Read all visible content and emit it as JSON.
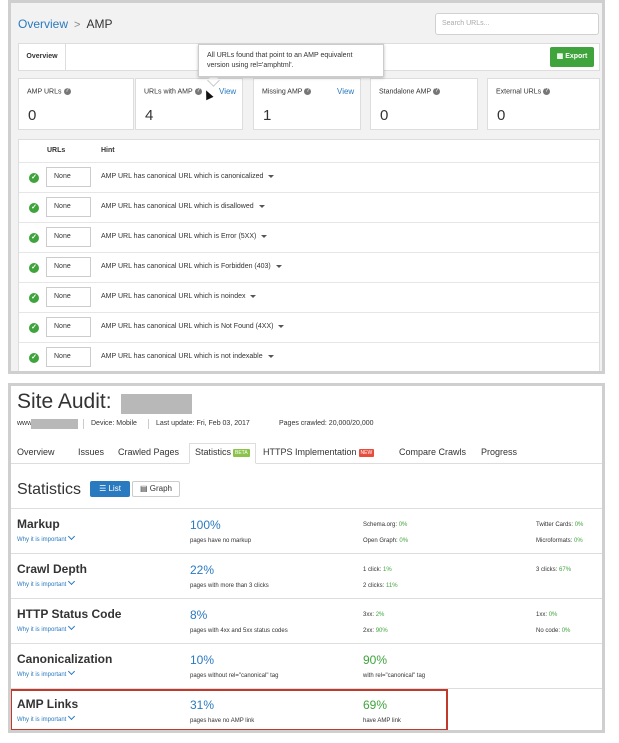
{
  "top": {
    "breadcrumb": {
      "overview": "Overview",
      "separator": ">",
      "current": "AMP"
    },
    "search_placeholder": "Search URLs...",
    "tab_overview": "Overview",
    "export_label": "Export",
    "tooltip": {
      "line1": "All URLs found that point to an AMP equivalent",
      "line2": "version using rel='amphtml'."
    },
    "cards": [
      {
        "label": "AMP URLs",
        "value": "0",
        "view": ""
      },
      {
        "label": "URLs with AMP",
        "value": "4",
        "view": "View"
      },
      {
        "label": "Missing AMP",
        "value": "1",
        "view": "View"
      },
      {
        "label": "Standalone AMP",
        "value": "0",
        "view": ""
      },
      {
        "label": "External URLs",
        "value": "0",
        "view": ""
      }
    ],
    "hints_header": {
      "urls": "URLs",
      "hint": "Hint"
    },
    "hint_rows": [
      {
        "value": "None",
        "text": "AMP URL has canonical URL which is canonicalized"
      },
      {
        "value": "None",
        "text": "AMP URL has canonical URL which is disallowed"
      },
      {
        "value": "None",
        "text": "AMP URL has canonical URL which is Error (5XX)"
      },
      {
        "value": "None",
        "text": "AMP URL has canonical URL which is Forbidden (403)"
      },
      {
        "value": "None",
        "text": "AMP URL has canonical URL which is noindex"
      },
      {
        "value": "None",
        "text": "AMP URL has canonical URL which is Not Found (4XX)"
      },
      {
        "value": "None",
        "text": "AMP URL has canonical URL which is not indexable"
      }
    ]
  },
  "bottom": {
    "title": "Site Audit:",
    "www": "www.",
    "device": "Device: Mobile",
    "last_update": "Last update: Fri, Feb 03, 2017",
    "pages_crawled": "Pages crawled: 20,000/20,000",
    "tabs": [
      {
        "label": "Overview"
      },
      {
        "label": "Issues"
      },
      {
        "label": "Crawled Pages"
      },
      {
        "label": "Statistics",
        "badge": "BETA"
      },
      {
        "label": "HTTPS Implementation",
        "badge": "NEW"
      },
      {
        "label": "Compare Crawls"
      },
      {
        "label": "Progress"
      }
    ],
    "statistics_heading": "Statistics",
    "btn_list": "List",
    "btn_graph": "Graph",
    "why_label": "Why it is important",
    "rows": [
      {
        "name": "Markup",
        "pct1": "100%",
        "desc1": "pages have no markup",
        "m1": "Schema.org:",
        "v1": "0%",
        "m2": "Open Graph:",
        "v2": "0%",
        "m3": "Twitter Cards:",
        "v3": "0%",
        "m4": "Microformats:",
        "v4": "0%"
      },
      {
        "name": "Crawl Depth",
        "pct1": "22%",
        "desc1": "pages with more than 3 clicks",
        "m1": "1 click:",
        "v1": "1%",
        "m2": "2 clicks:",
        "v2": "11%",
        "m3": "3 clicks:",
        "v3": "67%"
      },
      {
        "name": "HTTP Status Code",
        "pct1": "8%",
        "desc1": "pages with 4xx and 5xx status codes",
        "m1": "3xx:",
        "v1": "2%",
        "m2": "2xx:",
        "v2": "90%",
        "m3": "1xx:",
        "v3": "0%",
        "m4": "No code:",
        "v4": "0%"
      },
      {
        "name": "Canonicalization",
        "pct1": "10%",
        "desc1": "pages without rel=\"canonical\" tag",
        "pct2": "90%",
        "desc2": "with rel=\"canonical\" tag"
      },
      {
        "name": "AMP Links",
        "pct1": "31%",
        "desc1": "pages have no AMP link",
        "pct2": "69%",
        "desc2": "have AMP link"
      }
    ]
  },
  "colors": {
    "accent": "#2a7ac0",
    "green": "#3fa43b",
    "highlight": "#c0392b",
    "beta": "#8bc34a",
    "new": "#e74c3c"
  }
}
